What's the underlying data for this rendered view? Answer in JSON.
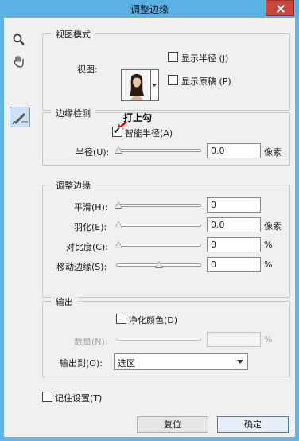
{
  "window": {
    "title": "调整边缘"
  },
  "tools": {
    "zoom_icon": "zoom-icon",
    "hand_icon": "hand-icon",
    "refine_icon": "refine-brush-icon"
  },
  "view_mode": {
    "legend": "视图模式",
    "view_label": "视图:",
    "show_radius": "显示半径 (J)",
    "show_original": "显示原稿 (P)"
  },
  "edge_detection": {
    "legend": "边缘检测",
    "smart_radius": "智能半径(A)",
    "smart_radius_checked": true,
    "radius_label": "半径(U):",
    "radius_value": "0.0",
    "radius_unit": "像素"
  },
  "adjust_edge": {
    "legend": "调整边缘",
    "smooth_label": "平滑(H):",
    "smooth_value": "0",
    "feather_label": "羽化(E):",
    "feather_value": "0.0",
    "feather_unit": "像素",
    "contrast_label": "对比度(C):",
    "contrast_value": "0",
    "contrast_unit": "%",
    "shift_label": "移动边缘(S):",
    "shift_value": "0",
    "shift_unit": "%"
  },
  "output": {
    "legend": "输出",
    "decontaminate": "净化颜色(D)",
    "amount_label": "数量(N):",
    "amount_unit": "%",
    "output_to_label": "输出到(O):",
    "output_to_value": "选区"
  },
  "remember": "记住设置(T)",
  "buttons": {
    "reset": "复位",
    "ok": "确定"
  },
  "annotation": "打上勾"
}
